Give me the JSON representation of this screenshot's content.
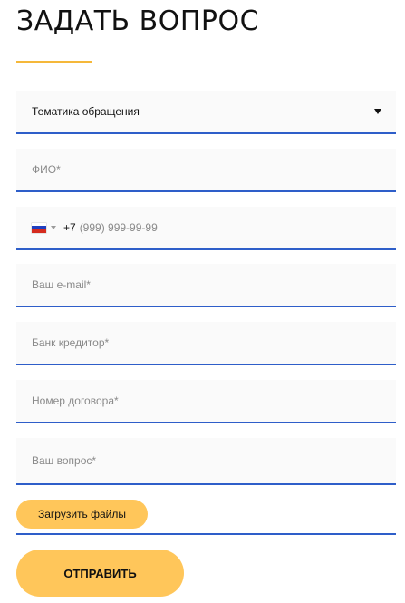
{
  "page": {
    "title": "ЗАДАТЬ ВОПРОС",
    "accent_color": "#f5b83a",
    "field_border_color": "#2e5ec9",
    "button_color": "#ffc65a"
  },
  "form": {
    "topic": {
      "selected_value": "Тематика обращения",
      "icon": "triangle-down-icon"
    },
    "name": {
      "placeholder": "ФИО*"
    },
    "phone": {
      "country_flag": "russia-flag-icon",
      "dropdown_icon": "small-triangle-down-icon",
      "dial_code": "+7",
      "placeholder": "(999) 999-99-99"
    },
    "email": {
      "placeholder": "Ваш e-mail*"
    },
    "bank": {
      "placeholder": "Банк кредитор*"
    },
    "contract": {
      "placeholder": "Номер договора*"
    },
    "question": {
      "placeholder": "Ваш вопрос*"
    },
    "upload_label": "Загрузить файлы",
    "submit_label": "ОТПРАВИТЬ"
  }
}
